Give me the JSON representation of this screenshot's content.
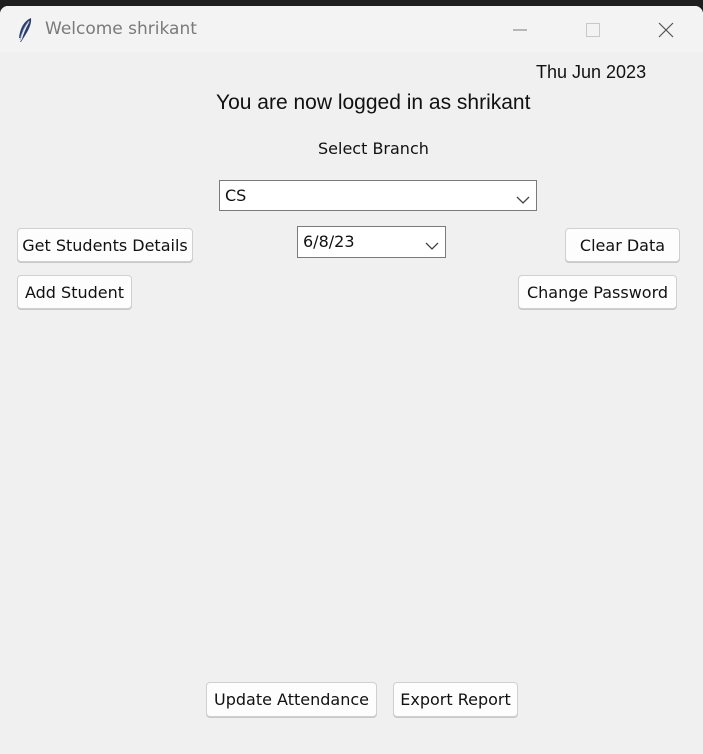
{
  "window": {
    "title": "Welcome shrikant",
    "icon": "feather-icon"
  },
  "header": {
    "date": "Thu Jun  2023",
    "welcome": "You are now logged in as shrikant",
    "branch_label": "Select Branch"
  },
  "branch_select": {
    "value": "CS"
  },
  "date_select": {
    "value": "6/8/23"
  },
  "buttons": {
    "get_students_details": "Get Students Details",
    "clear_data": "Clear Data",
    "add_student": "Add Student",
    "change_password": "Change Password",
    "update_attendance": "Update Attendance",
    "export_report": "Export Report"
  }
}
